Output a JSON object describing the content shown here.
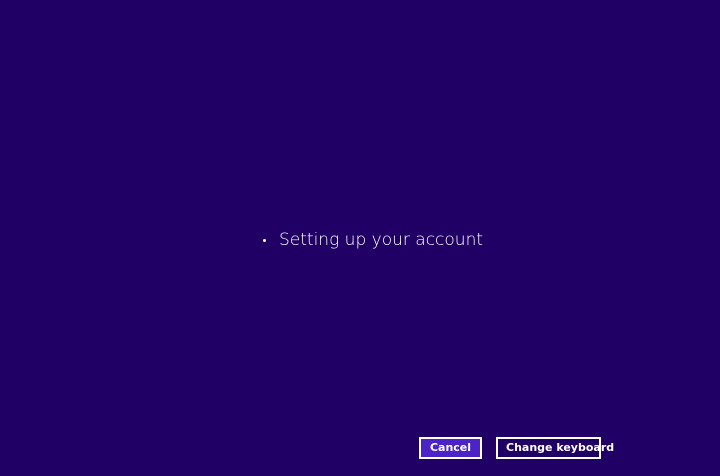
{
  "status": {
    "text": "Setting up your account"
  },
  "buttons": {
    "cancel": "Cancel",
    "change_keyboard": "Change keyboard"
  },
  "colors": {
    "background": "#200064",
    "accent_button": "#4b23c7",
    "text": "#ffffff"
  },
  "icons": {
    "progress": "progress-spinner-icon"
  }
}
